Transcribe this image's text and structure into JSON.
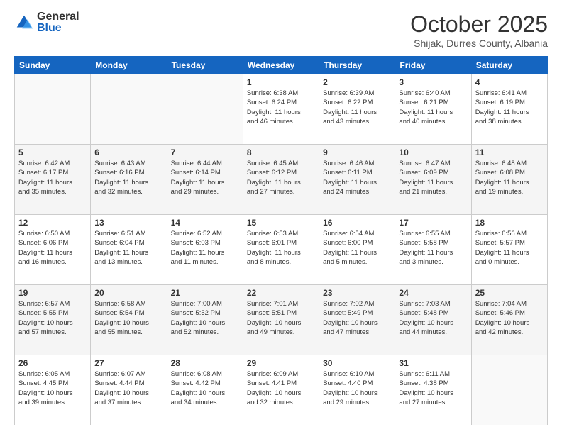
{
  "logo": {
    "general": "General",
    "blue": "Blue"
  },
  "header": {
    "month": "October 2025",
    "location": "Shijak, Durres County, Albania"
  },
  "weekdays": [
    "Sunday",
    "Monday",
    "Tuesday",
    "Wednesday",
    "Thursday",
    "Friday",
    "Saturday"
  ],
  "weeks": [
    [
      {
        "day": "",
        "info": ""
      },
      {
        "day": "",
        "info": ""
      },
      {
        "day": "",
        "info": ""
      },
      {
        "day": "1",
        "info": "Sunrise: 6:38 AM\nSunset: 6:24 PM\nDaylight: 11 hours\nand 46 minutes."
      },
      {
        "day": "2",
        "info": "Sunrise: 6:39 AM\nSunset: 6:22 PM\nDaylight: 11 hours\nand 43 minutes."
      },
      {
        "day": "3",
        "info": "Sunrise: 6:40 AM\nSunset: 6:21 PM\nDaylight: 11 hours\nand 40 minutes."
      },
      {
        "day": "4",
        "info": "Sunrise: 6:41 AM\nSunset: 6:19 PM\nDaylight: 11 hours\nand 38 minutes."
      }
    ],
    [
      {
        "day": "5",
        "info": "Sunrise: 6:42 AM\nSunset: 6:17 PM\nDaylight: 11 hours\nand 35 minutes."
      },
      {
        "day": "6",
        "info": "Sunrise: 6:43 AM\nSunset: 6:16 PM\nDaylight: 11 hours\nand 32 minutes."
      },
      {
        "day": "7",
        "info": "Sunrise: 6:44 AM\nSunset: 6:14 PM\nDaylight: 11 hours\nand 29 minutes."
      },
      {
        "day": "8",
        "info": "Sunrise: 6:45 AM\nSunset: 6:12 PM\nDaylight: 11 hours\nand 27 minutes."
      },
      {
        "day": "9",
        "info": "Sunrise: 6:46 AM\nSunset: 6:11 PM\nDaylight: 11 hours\nand 24 minutes."
      },
      {
        "day": "10",
        "info": "Sunrise: 6:47 AM\nSunset: 6:09 PM\nDaylight: 11 hours\nand 21 minutes."
      },
      {
        "day": "11",
        "info": "Sunrise: 6:48 AM\nSunset: 6:08 PM\nDaylight: 11 hours\nand 19 minutes."
      }
    ],
    [
      {
        "day": "12",
        "info": "Sunrise: 6:50 AM\nSunset: 6:06 PM\nDaylight: 11 hours\nand 16 minutes."
      },
      {
        "day": "13",
        "info": "Sunrise: 6:51 AM\nSunset: 6:04 PM\nDaylight: 11 hours\nand 13 minutes."
      },
      {
        "day": "14",
        "info": "Sunrise: 6:52 AM\nSunset: 6:03 PM\nDaylight: 11 hours\nand 11 minutes."
      },
      {
        "day": "15",
        "info": "Sunrise: 6:53 AM\nSunset: 6:01 PM\nDaylight: 11 hours\nand 8 minutes."
      },
      {
        "day": "16",
        "info": "Sunrise: 6:54 AM\nSunset: 6:00 PM\nDaylight: 11 hours\nand 5 minutes."
      },
      {
        "day": "17",
        "info": "Sunrise: 6:55 AM\nSunset: 5:58 PM\nDaylight: 11 hours\nand 3 minutes."
      },
      {
        "day": "18",
        "info": "Sunrise: 6:56 AM\nSunset: 5:57 PM\nDaylight: 11 hours\nand 0 minutes."
      }
    ],
    [
      {
        "day": "19",
        "info": "Sunrise: 6:57 AM\nSunset: 5:55 PM\nDaylight: 10 hours\nand 57 minutes."
      },
      {
        "day": "20",
        "info": "Sunrise: 6:58 AM\nSunset: 5:54 PM\nDaylight: 10 hours\nand 55 minutes."
      },
      {
        "day": "21",
        "info": "Sunrise: 7:00 AM\nSunset: 5:52 PM\nDaylight: 10 hours\nand 52 minutes."
      },
      {
        "day": "22",
        "info": "Sunrise: 7:01 AM\nSunset: 5:51 PM\nDaylight: 10 hours\nand 49 minutes."
      },
      {
        "day": "23",
        "info": "Sunrise: 7:02 AM\nSunset: 5:49 PM\nDaylight: 10 hours\nand 47 minutes."
      },
      {
        "day": "24",
        "info": "Sunrise: 7:03 AM\nSunset: 5:48 PM\nDaylight: 10 hours\nand 44 minutes."
      },
      {
        "day": "25",
        "info": "Sunrise: 7:04 AM\nSunset: 5:46 PM\nDaylight: 10 hours\nand 42 minutes."
      }
    ],
    [
      {
        "day": "26",
        "info": "Sunrise: 6:05 AM\nSunset: 4:45 PM\nDaylight: 10 hours\nand 39 minutes."
      },
      {
        "day": "27",
        "info": "Sunrise: 6:07 AM\nSunset: 4:44 PM\nDaylight: 10 hours\nand 37 minutes."
      },
      {
        "day": "28",
        "info": "Sunrise: 6:08 AM\nSunset: 4:42 PM\nDaylight: 10 hours\nand 34 minutes."
      },
      {
        "day": "29",
        "info": "Sunrise: 6:09 AM\nSunset: 4:41 PM\nDaylight: 10 hours\nand 32 minutes."
      },
      {
        "day": "30",
        "info": "Sunrise: 6:10 AM\nSunset: 4:40 PM\nDaylight: 10 hours\nand 29 minutes."
      },
      {
        "day": "31",
        "info": "Sunrise: 6:11 AM\nSunset: 4:38 PM\nDaylight: 10 hours\nand 27 minutes."
      },
      {
        "day": "",
        "info": ""
      }
    ]
  ]
}
